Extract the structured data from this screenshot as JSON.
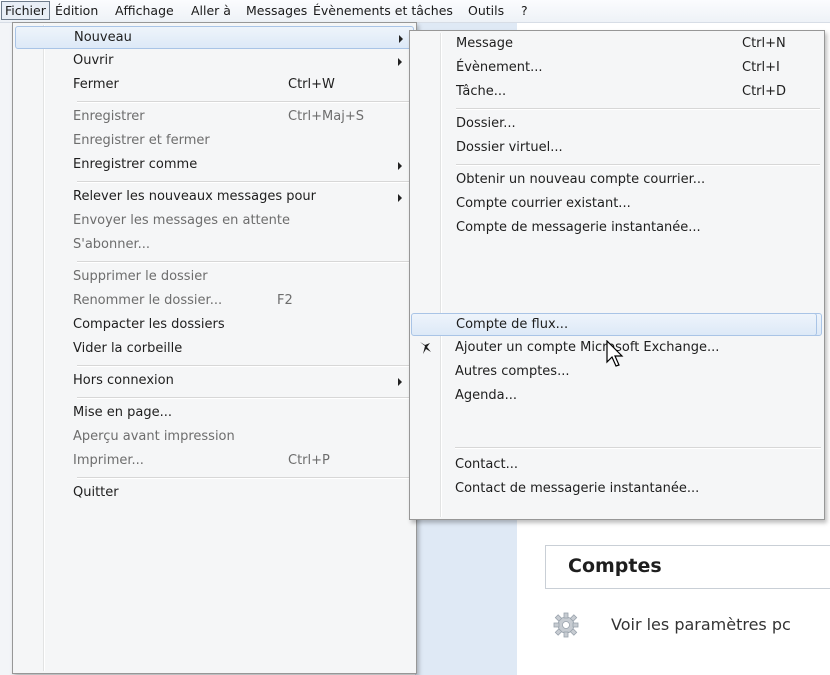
{
  "menubar": {
    "items": [
      "Fichier",
      "Édition",
      "Affichage",
      "Aller à",
      "Messages",
      "Évènements et tâches",
      "Outils",
      "?"
    ]
  },
  "file_menu": {
    "items": [
      {
        "label": "Nouveau",
        "shortcut": "",
        "submenu": true,
        "disabled": false
      },
      {
        "label": "Ouvrir",
        "shortcut": "",
        "submenu": true,
        "disabled": false
      },
      {
        "label": "Fermer",
        "shortcut": "Ctrl+W",
        "submenu": false,
        "disabled": false
      },
      {
        "label": "Enregistrer",
        "shortcut": "Ctrl+Maj+S",
        "submenu": false,
        "disabled": true
      },
      {
        "label": "Enregistrer et fermer",
        "shortcut": "",
        "submenu": false,
        "disabled": true
      },
      {
        "label": "Enregistrer comme",
        "shortcut": "",
        "submenu": true,
        "disabled": false
      },
      {
        "label": "Relever les nouveaux messages pour",
        "shortcut": "",
        "submenu": true,
        "disabled": false
      },
      {
        "label": "Envoyer les messages en attente",
        "shortcut": "",
        "submenu": false,
        "disabled": true
      },
      {
        "label": "S'abonner...",
        "shortcut": "",
        "submenu": false,
        "disabled": true
      },
      {
        "label": "Supprimer le dossier",
        "shortcut": "",
        "submenu": false,
        "disabled": true
      },
      {
        "label": "Renommer le dossier...",
        "shortcut": "F2",
        "submenu": false,
        "disabled": true
      },
      {
        "label": "Compacter les dossiers",
        "shortcut": "",
        "submenu": false,
        "disabled": false
      },
      {
        "label": "Vider la corbeille",
        "shortcut": "",
        "submenu": false,
        "disabled": false
      },
      {
        "label": "Hors connexion",
        "shortcut": "",
        "submenu": true,
        "disabled": false
      },
      {
        "label": "Mise en page...",
        "shortcut": "",
        "submenu": false,
        "disabled": false
      },
      {
        "label": "Aperçu avant impression",
        "shortcut": "",
        "submenu": false,
        "disabled": true
      },
      {
        "label": "Imprimer...",
        "shortcut": "Ctrl+P",
        "submenu": false,
        "disabled": true
      },
      {
        "label": "Quitter",
        "shortcut": "",
        "submenu": false,
        "disabled": false
      }
    ]
  },
  "new_submenu": {
    "items": [
      {
        "label": "Message",
        "shortcut": "Ctrl+N"
      },
      {
        "label": "Évènement...",
        "shortcut": "Ctrl+I"
      },
      {
        "label": "Tâche...",
        "shortcut": "Ctrl+D"
      },
      {
        "label": "Dossier...",
        "shortcut": ""
      },
      {
        "label": "Dossier virtuel...",
        "shortcut": ""
      },
      {
        "label": "Obtenir un nouveau compte courrier...",
        "shortcut": ""
      },
      {
        "label": "Compte courrier existant...",
        "shortcut": ""
      },
      {
        "label": "Compte de messagerie instantanée...",
        "shortcut": ""
      },
      {
        "label": "Compte de flux...",
        "shortcut": ""
      },
      {
        "label": "Ajouter un compte Microsoft Exchange...",
        "shortcut": ""
      },
      {
        "label": "Autres comptes...",
        "shortcut": ""
      },
      {
        "label": "Agenda...",
        "shortcut": ""
      },
      {
        "label": "Contact...",
        "shortcut": ""
      },
      {
        "label": "Contact de messagerie instantanée...",
        "shortcut": ""
      }
    ]
  },
  "content": {
    "accounts_title": "Comptes",
    "settings_text": "Voir les paramètres pc"
  },
  "colors": {
    "highlight_border": "#a9c4e6",
    "menu_bg": "#f5f6f7"
  }
}
